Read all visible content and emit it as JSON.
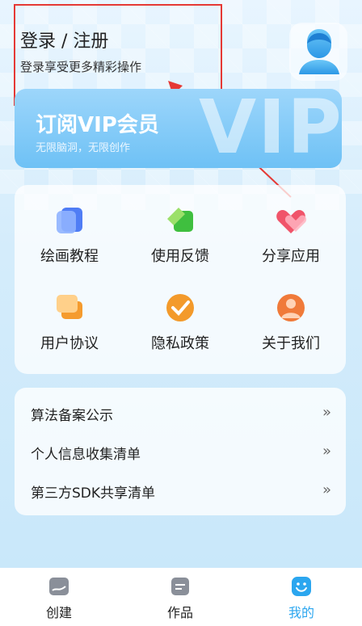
{
  "header": {
    "login_title": "登录 / 注册",
    "login_subtitle": "登录享受更多精彩操作"
  },
  "vip": {
    "title": "订阅VIP会员",
    "subtitle": "无限脑洞，无限创作",
    "watermark": "VIP"
  },
  "grid": [
    {
      "label": "绘画教程",
      "icon": "tutorial-icon"
    },
    {
      "label": "使用反馈",
      "icon": "feedback-icon"
    },
    {
      "label": "分享应用",
      "icon": "share-icon"
    },
    {
      "label": "用户协议",
      "icon": "agreement-icon"
    },
    {
      "label": "隐私政策",
      "icon": "privacy-icon"
    },
    {
      "label": "关于我们",
      "icon": "about-icon"
    }
  ],
  "list": [
    {
      "label": "算法备案公示",
      "chevron": "»"
    },
    {
      "label": "个人信息收集清单",
      "chevron": "»"
    },
    {
      "label": "第三方SDK共享清单",
      "chevron": "»"
    }
  ],
  "tabs": [
    {
      "label": "创建",
      "icon": "create-icon"
    },
    {
      "label": "作品",
      "icon": "works-icon"
    },
    {
      "label": "我的",
      "icon": "mine-icon",
      "active": true
    }
  ],
  "colors": {
    "accent": "#2ba6ef",
    "highlight": "#e53935"
  }
}
